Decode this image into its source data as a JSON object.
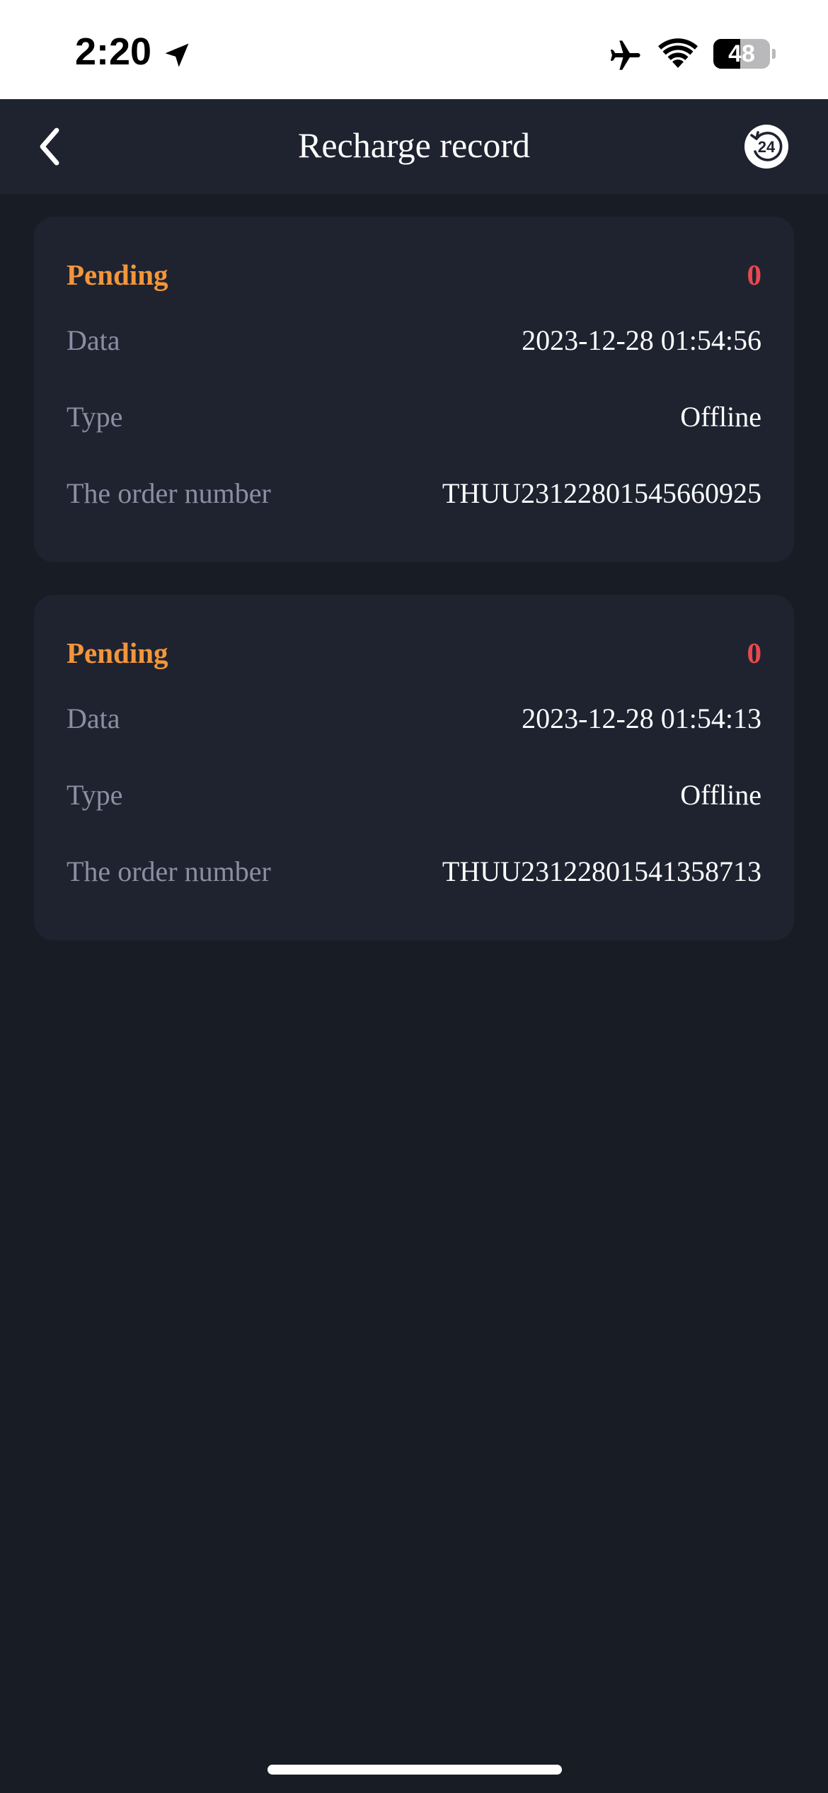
{
  "status_bar": {
    "time": "2:20",
    "battery_level": "48",
    "battery_fraction": 0.48,
    "icons": [
      "location-arrow-icon",
      "airplane-mode-icon",
      "wifi-icon",
      "battery-icon"
    ]
  },
  "header": {
    "title": "Recharge record",
    "back_icon": "chevron-left-icon",
    "support_icon": "support-24h-icon"
  },
  "colors": {
    "background": "#181c24",
    "card": "#1f2330",
    "status_pending": "#f3963a",
    "amount": "#e8484f",
    "label": "#8a90a3",
    "value": "#ffffff"
  },
  "records": [
    {
      "status": "Pending",
      "amount": "0",
      "date_label": "Data",
      "date_value": "2023-12-28 01:54:56",
      "type_label": "Type",
      "type_value": "Offline",
      "order_label": "The order number",
      "order_value": "THUU23122801545660925"
    },
    {
      "status": "Pending",
      "amount": "0",
      "date_label": "Data",
      "date_value": "2023-12-28 01:54:13",
      "type_label": "Type",
      "type_value": "Offline",
      "order_label": "The order number",
      "order_value": "THUU23122801541358713"
    }
  ]
}
